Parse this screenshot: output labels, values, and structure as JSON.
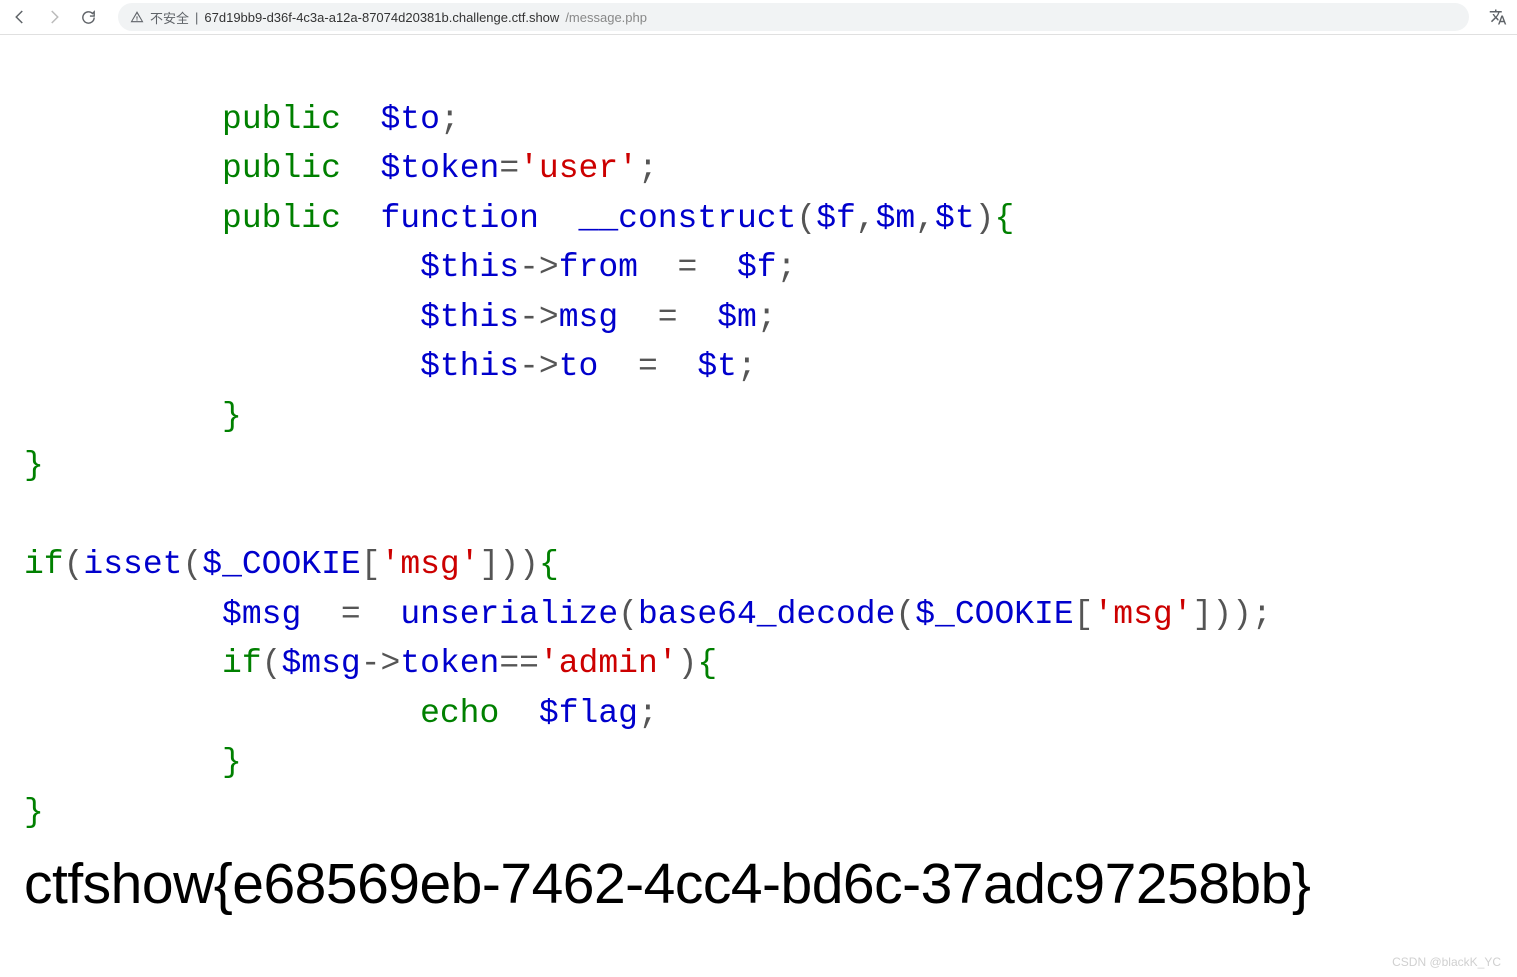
{
  "browser": {
    "insecure_label": "不安全",
    "url_sep": " | ",
    "url_host": "67d19bb9-d36f-4c3a-a12a-87074d20381b.challenge.ctf.show",
    "url_path": "/message.php"
  },
  "code": {
    "l1_kw": "public",
    "l1_var": "$to",
    "l2_kw": "public",
    "l2_var": "$token",
    "l2_str": "'user'",
    "l3_kw": "public",
    "l3_fn": "function",
    "l3_name": "__construct",
    "l3_p1": "$f",
    "l3_p2": "$m",
    "l3_p3": "$t",
    "l4_this": "$this",
    "l4_arrow": "->",
    "l4_prop": "from",
    "l4_eq": " = ",
    "l4_val": "$f",
    "l5_this": "$this",
    "l5_arrow": "->",
    "l5_prop": "msg",
    "l5_eq": " = ",
    "l5_val": "$m",
    "l6_this": "$this",
    "l6_arrow": "->",
    "l6_prop": "to",
    "l6_eq": " = ",
    "l6_val": "$t",
    "if_kw": "if",
    "isset": "isset",
    "cookie": "$_COOKIE",
    "msg_str": "'msg'",
    "l10_var": "$msg",
    "l10_eq": " = ",
    "l10_unser": "unserialize",
    "l10_b64": "base64_decode",
    "l11_if": "if",
    "l11_var": "$msg",
    "l11_arrow": "->",
    "l11_prop": "token",
    "l11_eq": "==",
    "l11_str": "'admin'",
    "l12_echo": "echo",
    "l12_var": "$flag",
    "semi": ";",
    "comma": ",",
    "lbr": "{",
    "rbr": "}",
    "lp": "(",
    "rp": ")",
    "lsq": "[",
    "rsq": "]"
  },
  "flag": "ctfshow{e68569eb-7462-4cc4-bd6c-37adc97258bb}",
  "watermark": "CSDN @blackK_YC"
}
